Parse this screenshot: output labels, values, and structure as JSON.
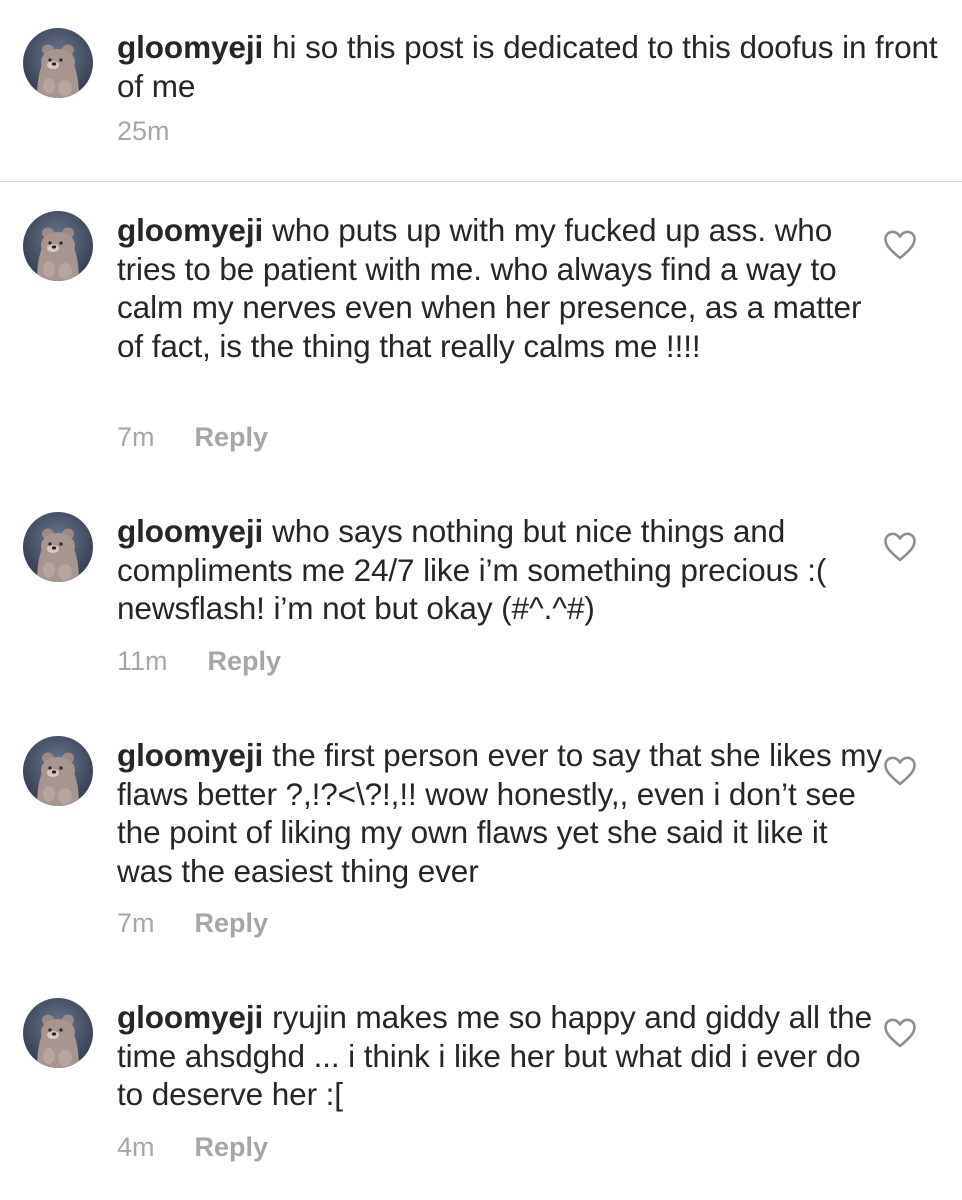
{
  "caption": {
    "username": "gloomyeji",
    "text": "hi so this post is dedicated to this doofus in front of me",
    "time": "25m"
  },
  "comments": [
    {
      "username": "gloomyeji",
      "text": "who puts up with my fucked up ass. who tries to be patient with me. who always find a way to calm my nerves even when her presence, as a matter of fact, is the thing that really calms me !!!!",
      "time": "7m",
      "reply_label": "Reply"
    },
    {
      "username": "gloomyeji",
      "text": "who says nothing but nice things and compliments me 24/7 like i’m something precious :( newsflash! i’m not but okay (#^.^#)",
      "time": "11m",
      "reply_label": "Reply"
    },
    {
      "username": "gloomyeji",
      "text": "the first person ever to say that she likes my flaws better ?,!?<\\?!,!! wow honestly,, even i don’t see the point of liking my own flaws yet she said it like it was the easiest thing ever",
      "time": "7m",
      "reply_label": "Reply"
    },
    {
      "username": "gloomyeji",
      "text": "ryujin makes me so happy and giddy all the time ahsdghd ... i think i like her but what did i ever do to deserve her :[",
      "time": "4m",
      "reply_label": "Reply"
    }
  ],
  "icons": {
    "like": "heart-outline-icon",
    "avatar": "bear-avatar"
  },
  "colors": {
    "text": "#262626",
    "meta": "#a6a6a6",
    "divider": "#dbdbdb",
    "heart": "#8e8e8e"
  }
}
